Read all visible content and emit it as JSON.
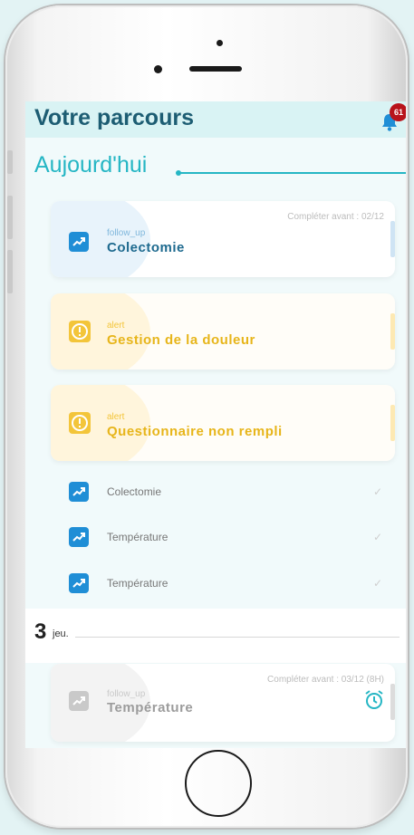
{
  "header": {
    "title": "Votre parcours",
    "notification_count": "61"
  },
  "today": {
    "title": "Aujourd'hui"
  },
  "cards": [
    {
      "type": "follow_up",
      "name": "Colectomie",
      "due": "Compléter avant : 02/12",
      "style": "blue",
      "icon": "trend-up-icon"
    },
    {
      "type": "alert",
      "name": "Gestion de la douleur",
      "due": "",
      "style": "yellow",
      "icon": "warning-icon"
    },
    {
      "type": "alert",
      "name": "Questionnaire non rempli",
      "due": "",
      "style": "yellow",
      "icon": "warning-icon"
    }
  ],
  "completed": [
    {
      "label": "Colectomie"
    },
    {
      "label": "Température"
    },
    {
      "label": "Température"
    }
  ],
  "next_day": {
    "number": "3",
    "weekday": "jeu.",
    "card": {
      "type": "follow_up",
      "name": "Température",
      "due": "Compléter avant : 03/12 (8H)",
      "icon": "alarm-clock-icon"
    }
  },
  "colors": {
    "primary": "#1d5d73",
    "accent": "#25b6c4",
    "follow_up_blue": "#1f8ed6",
    "alert_yellow": "#f3c53a",
    "badge_red": "#b8131b"
  }
}
